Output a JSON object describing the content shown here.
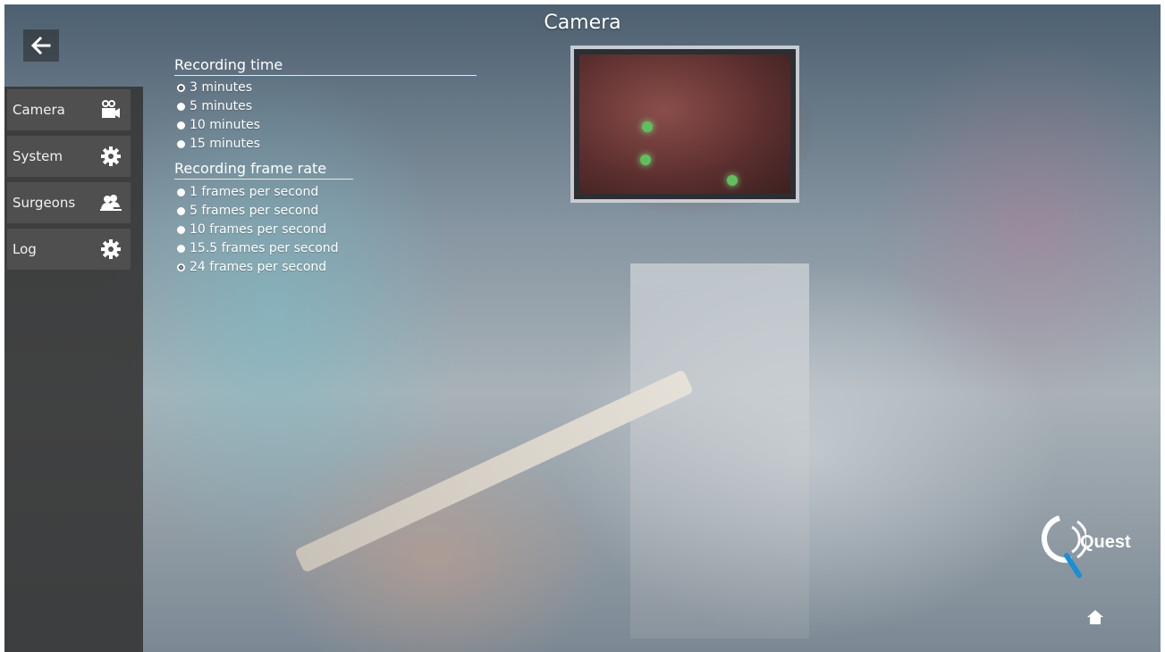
{
  "header": {
    "title": "Camera"
  },
  "back_button": {
    "icon": "arrow-left-icon"
  },
  "sidebar": {
    "items": [
      {
        "label": "Camera",
        "icon": "video-camera-icon"
      },
      {
        "label": "System",
        "icon": "gear-icon"
      },
      {
        "label": "Surgeons",
        "icon": "users-icon"
      },
      {
        "label": "Log",
        "icon": "gear-icon"
      }
    ]
  },
  "recording_time": {
    "title": "Recording time",
    "selected": "3 minutes",
    "options": [
      "3 minutes",
      "5 minutes",
      "10 minutes",
      "15 minutes"
    ]
  },
  "recording_frame_rate": {
    "title": "Recording frame rate",
    "selected": "24 frames per second",
    "options": [
      "1 frames per second",
      "5 frames per second",
      "10 frames per second",
      "15.5 frames per second",
      "24 frames per second"
    ]
  },
  "logo": {
    "text": "Quest"
  },
  "home_button": {
    "icon": "home-icon"
  }
}
